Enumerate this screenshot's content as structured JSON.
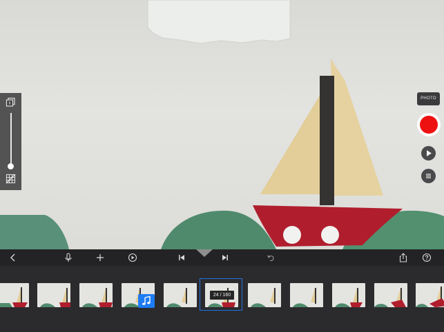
{
  "viewfinder": {
    "scene": "paper-sailboat-scene"
  },
  "capture": {
    "photo_label": "PHOTO"
  },
  "timeline": {
    "frame_counter": "24 / 160",
    "current_frame": 24,
    "total_frames": 160
  },
  "colors": {
    "record": "#ee1111",
    "selection": "#1f73e6",
    "music_badge": "#1d7cf2",
    "toolbar_bg": "#232325",
    "sail": "#e4cf9c",
    "hull": "#b01e2e",
    "hills": "#4f8a6c"
  },
  "icons": {
    "left_panel": [
      "layers-icon",
      "grid-off-icon"
    ],
    "toolbar": [
      "back-icon",
      "microphone-icon",
      "add-icon",
      "timer-icon",
      "skip-to-start-icon",
      "skip-to-end-icon",
      "undo-icon",
      "share-icon",
      "help-icon"
    ],
    "right_panel": [
      "play-icon",
      "menu-icon"
    ],
    "filmstrip": [
      "music-note-icon"
    ]
  }
}
